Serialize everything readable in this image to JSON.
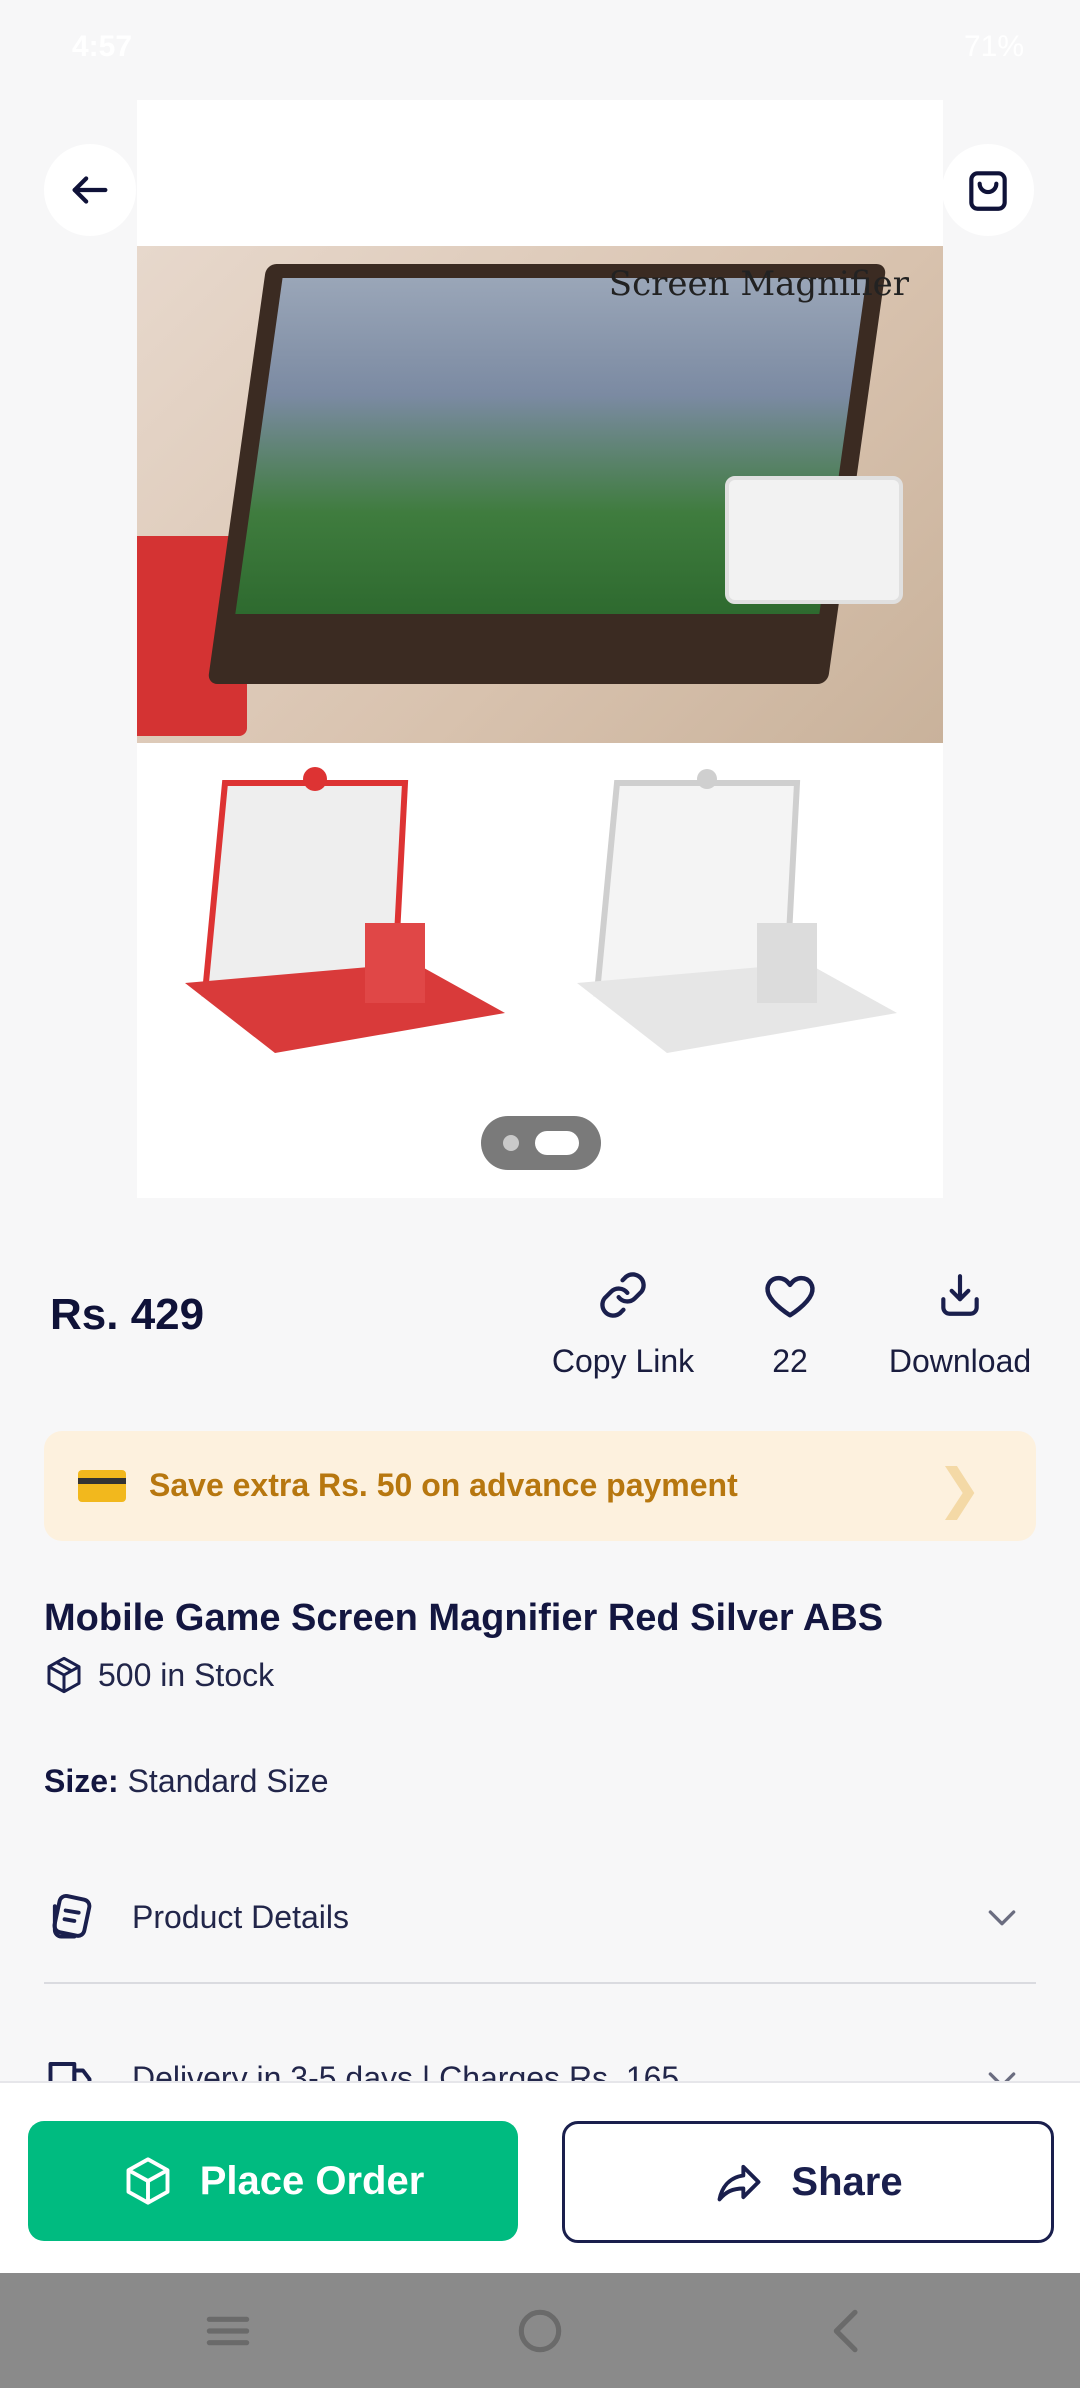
{
  "status_bar": {
    "time": "4:57",
    "battery": "71%"
  },
  "hero": {
    "caption": "Screen Magnifier"
  },
  "price": "Rs. 429",
  "actions": {
    "copy_link": "Copy Link",
    "likes": "22",
    "download": "Download"
  },
  "offer": {
    "text": "Save extra Rs. 50 on advance payment"
  },
  "product": {
    "title": "Mobile Game Screen Magnifier Red Silver ABS",
    "stock": "500 in Stock",
    "size_label": "Size:",
    "size_value": "Standard Size"
  },
  "accordions": [
    {
      "label": "Product Details"
    },
    {
      "label": "Delivery in 3-5 days | Charges Rs. 165"
    }
  ],
  "buttons": {
    "place_order": "Place Order",
    "share": "Share"
  },
  "colors": {
    "primary_green": "#00bb80",
    "navy": "#1a1f4d",
    "offer_bg": "#fdf1de",
    "offer_text": "#b7770f"
  }
}
